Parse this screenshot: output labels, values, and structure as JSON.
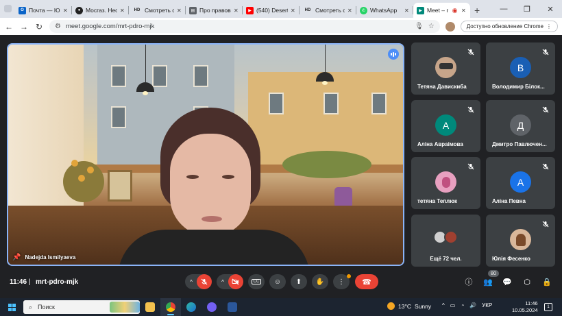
{
  "browser": {
    "tabs": [
      {
        "label": "Почта — ЮЭ",
        "icon": "outlook-icon",
        "color": "#0a64c8"
      },
      {
        "label": "Мосгаз. Нео",
        "icon": "mosgaz-icon",
        "color": "#222222"
      },
      {
        "label": "Смотреть се",
        "icon": "hd-icon",
        "color": "#333333"
      },
      {
        "label": "Про правово",
        "icon": "document-icon",
        "color": "#5f6368"
      },
      {
        "label": "(540) Desert",
        "icon": "youtube-icon",
        "color": "#ff0000"
      },
      {
        "label": "Смотреть се",
        "icon": "hd-icon",
        "color": "#333333"
      },
      {
        "label": "WhatsApp",
        "icon": "whatsapp-icon",
        "color": "#25d366"
      },
      {
        "label": "Meet – m",
        "icon": "meet-icon",
        "color": "#00897b",
        "active": true
      }
    ],
    "address": "meet.google.com/mrt-pdro-mjk",
    "update_label": "Доступно обновление Chrome"
  },
  "meeting": {
    "time": "11:46",
    "separator": "|",
    "code": "mrt-pdro-mjk",
    "main_speaker": "Nadejda Ismilyaeva",
    "participants_count": "80",
    "participants": [
      {
        "name": "Тетяна Давискиба",
        "initial": "",
        "color": "#c7a58a",
        "photo": true
      },
      {
        "name": "Володимир Білок...",
        "initial": "В",
        "color": "#1a5fb4"
      },
      {
        "name": "Аліна Авраімова",
        "initial": "А",
        "color": "#00897b"
      },
      {
        "name": "Дмитро Павлючен...",
        "initial": "Д",
        "color": "#5f6368"
      },
      {
        "name": "тетяна Теплюк",
        "initial": "",
        "color": "#e8a0c0",
        "photo": true
      },
      {
        "name": "Аліна Певна",
        "initial": "А",
        "color": "#1a73e8"
      },
      {
        "name": "Ещё 72 чел.",
        "initial": "",
        "color": "#3c4043",
        "more": true
      },
      {
        "name": "Юлія Фесенко",
        "initial": "",
        "color": "#d9b79a",
        "photo": true
      }
    ]
  },
  "taskbar": {
    "search_label": "Поиск",
    "weather_temp": "13°C",
    "weather_text": "Sunny",
    "lang": "УКР",
    "time": "11:46",
    "date": "10.05.2024",
    "notif_count": "1"
  }
}
